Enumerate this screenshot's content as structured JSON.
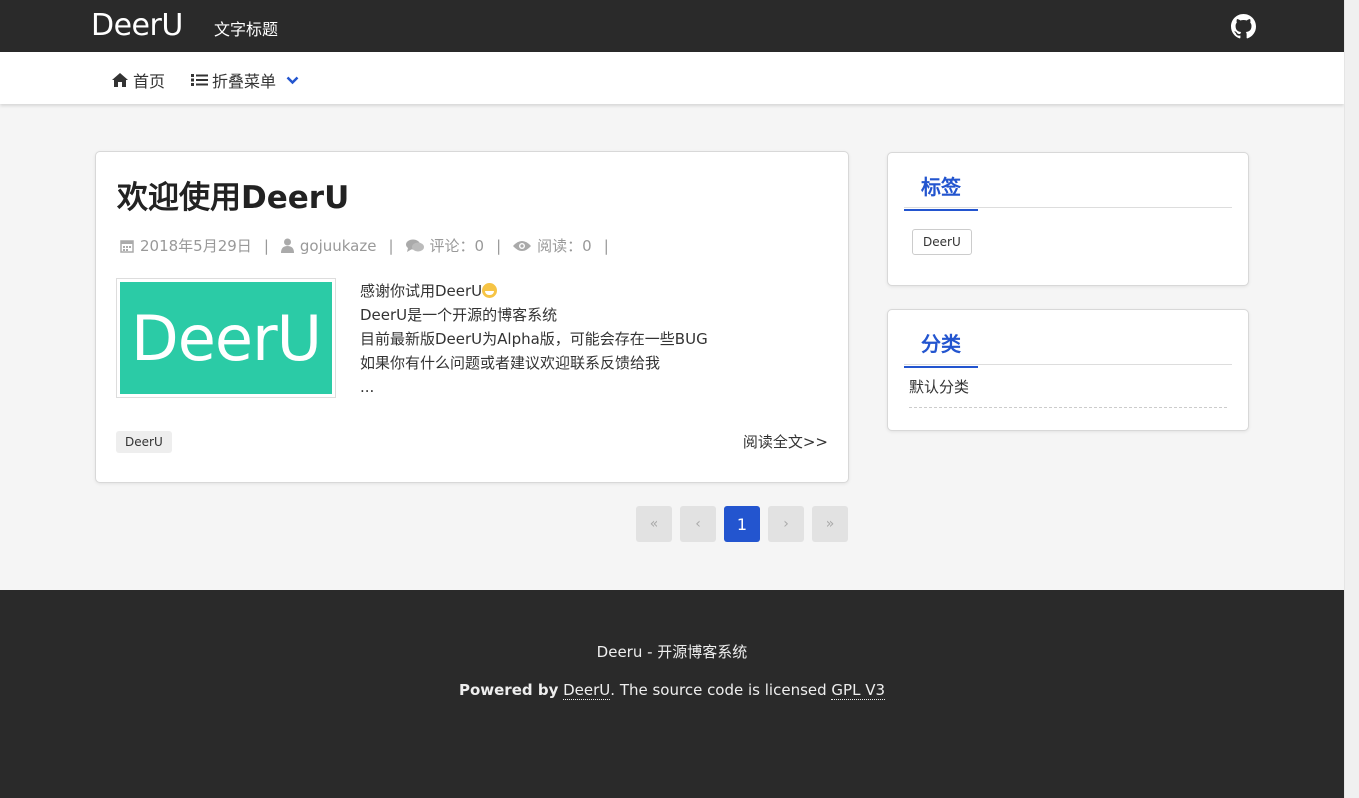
{
  "header": {
    "logo": "DeerU",
    "site_title": "文字标题",
    "github_icon": "github-icon"
  },
  "nav": {
    "home_label": "首页",
    "menu_label": "折叠菜单"
  },
  "post": {
    "title": "欢迎使用DeerU",
    "date": "2018年5月29日",
    "author": "gojuukaze",
    "comments": "评论：0",
    "reads": "阅读：0",
    "thumb_text": "DeerU",
    "excerpt_lines": [
      "感谢你试用DeerU",
      "DeerU是一个开源的博客系统",
      "目前最新版DeerU为Alpha版，可能会存在一些BUG",
      "如果你有什么问题或者建议欢迎联系反馈给我",
      "..."
    ],
    "tag": "DeerU",
    "read_more": "阅读全文>>"
  },
  "pagination": {
    "first": "«",
    "prev": "‹",
    "current": "1",
    "next": "›",
    "last": "»"
  },
  "sidebar": {
    "tags_title": "标签",
    "tags": [
      "DeerU"
    ],
    "categories_title": "分类",
    "categories": [
      "默认分类"
    ]
  },
  "footer": {
    "line1": "Deeru - 开源博客系统",
    "powered_by": "Powered by",
    "deeru_link": "DeerU",
    "license_text": ". The source code is licensed ",
    "license_link": "GPL V3"
  },
  "colors": {
    "accent": "#2355cf",
    "topbar": "#2a2a2a",
    "thumb_bg": "#2bcba6"
  }
}
